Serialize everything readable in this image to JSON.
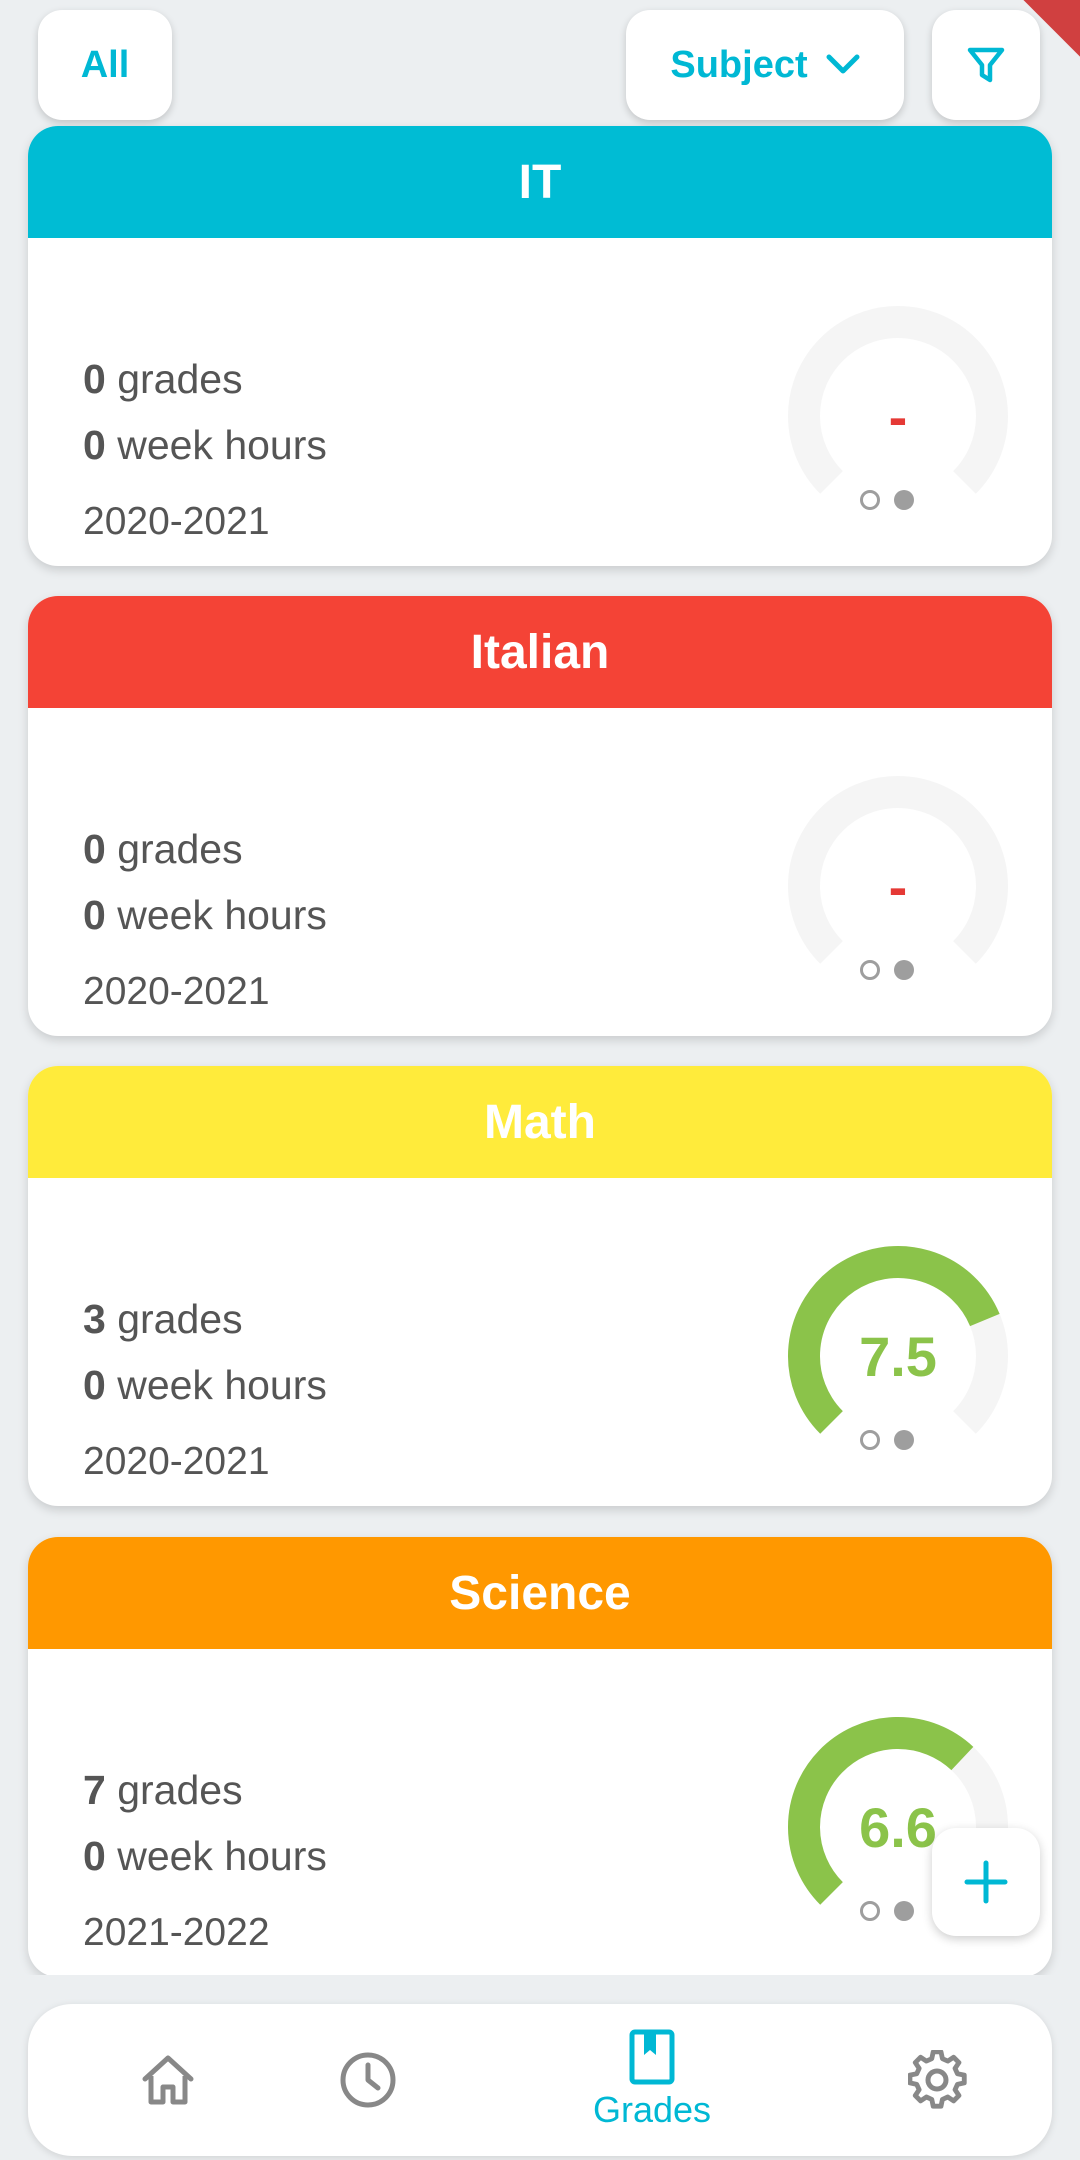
{
  "topbar": {
    "all_label": "All",
    "sort_label": "Subject"
  },
  "colors": {
    "accent": "#00b8d4",
    "it": "#00bcd4",
    "italian": "#f44336",
    "math": "#ffeb3b",
    "science": "#ff9800",
    "gauge_good": "#8bc34a",
    "gauge_none": "#e53935",
    "gauge_track": "#f5f5f5"
  },
  "subjects": [
    {
      "name": "IT",
      "grades": "0",
      "grades_label": "grades",
      "hours": "0",
      "hours_label": "week hours",
      "year": "2020-2021",
      "average": "-",
      "average_fraction": 0
    },
    {
      "name": "Italian",
      "grades": "0",
      "grades_label": "grades",
      "hours": "0",
      "hours_label": "week hours",
      "year": "2020-2021",
      "average": "-",
      "average_fraction": 0
    },
    {
      "name": "Math",
      "grades": "3",
      "grades_label": "grades",
      "hours": "0",
      "hours_label": "week hours",
      "year": "2020-2021",
      "average": "7.5",
      "average_fraction": 0.75
    },
    {
      "name": "Science",
      "grades": "7",
      "grades_label": "grades",
      "hours": "0",
      "hours_label": "week hours",
      "year": "2021-2022",
      "average": "6.6",
      "average_fraction": 0.66
    }
  ],
  "nav": {
    "active_label": "Grades"
  }
}
